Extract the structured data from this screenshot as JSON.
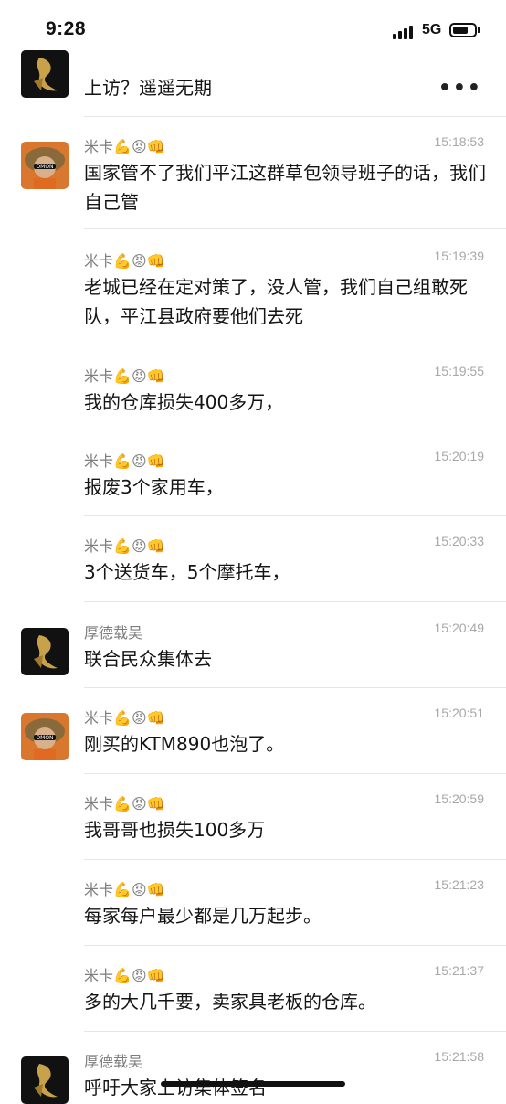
{
  "status_bar": {
    "time": "9:28",
    "network": "5G"
  },
  "header_message": {
    "text": "上访？遥遥无期",
    "more_icon": "more-dots"
  },
  "emoji_suffix": "💪😡👊",
  "messages": [
    {
      "sender": "米卡",
      "time": "15:18:53",
      "text": "国家管不了我们平江这群草包领导班子的话，我们自己管"
    },
    {
      "sender": "米卡",
      "time": "15:19:39",
      "text": "老城已经在定对策了，没人管，我们自己组敢死队，平江县政府要他们去死"
    },
    {
      "sender": "米卡",
      "time": "15:19:55",
      "text": "我的仓库损失400多万，"
    },
    {
      "sender": "米卡",
      "time": "15:20:19",
      "text": "报废3个家用车，"
    },
    {
      "sender": "米卡",
      "time": "15:20:33",
      "text": "3个送货车，5个摩托车，"
    },
    {
      "sender": "厚德载吴",
      "time": "15:20:49",
      "text": "联合民众集体去"
    },
    {
      "sender": "米卡",
      "time": "15:20:51",
      "text": "刚买的KTM890也泡了。"
    },
    {
      "sender": "米卡",
      "time": "15:20:59",
      "text": "我哥哥也损失100多万"
    },
    {
      "sender": "米卡",
      "time": "15:21:23",
      "text": "每家每户最少都是几万起步。"
    },
    {
      "sender": "米卡",
      "time": "15:21:37",
      "text": "多的大几千要，卖家具老板的仓库。"
    },
    {
      "sender": "厚德载吴",
      "time": "15:21:58",
      "text": "呼吁大家上访集体签名"
    }
  ],
  "colors": {
    "sender": "#7d7d7d",
    "time": "#a8a8a8",
    "divider": "#e6e6e6"
  }
}
